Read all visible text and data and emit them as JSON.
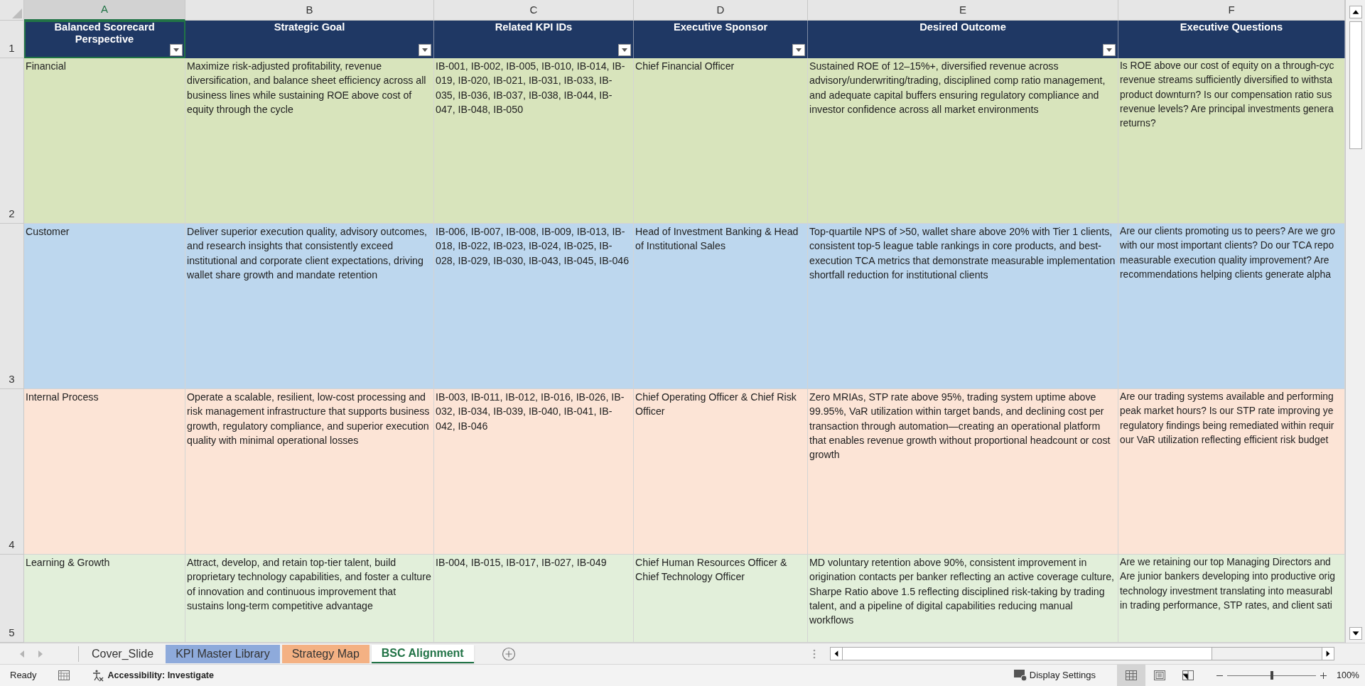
{
  "column_letters": [
    {
      "label": "A",
      "selected": true
    },
    {
      "label": "B",
      "selected": false
    },
    {
      "label": "C",
      "selected": false
    },
    {
      "label": "D",
      "selected": false
    },
    {
      "label": "E",
      "selected": false
    },
    {
      "label": "F",
      "selected": false
    }
  ],
  "header_row": {
    "row_number": "1",
    "cells": [
      {
        "text": "Balanced Scorecard Perspective",
        "filter": true,
        "selected": true
      },
      {
        "text": "Strategic Goal",
        "filter": true,
        "selected": false
      },
      {
        "text": "Related KPI IDs",
        "filter": true,
        "selected": false
      },
      {
        "text": "Executive Sponsor",
        "filter": true,
        "selected": false
      },
      {
        "text": "Desired Outcome",
        "filter": true,
        "selected": false
      },
      {
        "text": "Executive Questions",
        "filter": false,
        "selected": false
      }
    ]
  },
  "rows": [
    {
      "row_number": "2",
      "color": "#d8e4bc",
      "cells": [
        {
          "text": "Financial"
        },
        {
          "text": "Maximize risk-adjusted profitability, revenue diversification, and balance sheet efficiency across all business lines while sustaining ROE above cost of equity through the cycle"
        },
        {
          "text": "IB-001, IB-002, IB-005, IB-010, IB-014, IB-019, IB-020, IB-021, IB-031, IB-033, IB-035, IB-036, IB-037, IB-038, IB-044, IB-047, IB-048, IB-050"
        },
        {
          "text": "Chief Financial Officer"
        },
        {
          "text": "Sustained ROE of 12–15%+, diversified revenue across advisory/underwriting/trading, disciplined comp ratio management, and adequate capital buffers ensuring regulatory compliance and investor confidence across all market environments"
        },
        {
          "lines": [
            "Is ROE above our cost of equity on a through-cyc",
            "revenue streams sufficiently diversified to withsta",
            "product downturn? Is our compensation ratio sus",
            "revenue levels? Are principal investments genera",
            "returns?"
          ]
        }
      ]
    },
    {
      "row_number": "3",
      "color": "#bdd7ee",
      "cells": [
        {
          "text": "Customer"
        },
        {
          "text": "Deliver superior execution quality, advisory outcomes, and research insights that consistently exceed institutional and corporate client expectations, driving wallet share growth and mandate retention"
        },
        {
          "text": "IB-006, IB-007, IB-008, IB-009, IB-013, IB-018, IB-022, IB-023, IB-024, IB-025, IB-028, IB-029, IB-030, IB-043, IB-045, IB-046"
        },
        {
          "text": "Head of Investment Banking & Head of Institutional Sales"
        },
        {
          "text": "Top-quartile NPS of >50, wallet share above 20% with Tier 1 clients, consistent top-5 league table rankings in core products, and best-execution TCA metrics that demonstrate measurable implementation shortfall reduction for institutional clients"
        },
        {
          "lines": [
            "Are our clients promoting us to peers? Are we gro",
            "with our most important clients? Do our TCA repo",
            "measurable execution quality improvement? Are",
            "recommendations helping clients generate alpha"
          ]
        }
      ]
    },
    {
      "row_number": "4",
      "color": "#fce4d6",
      "cells": [
        {
          "text": "Internal Process"
        },
        {
          "text": "Operate a scalable, resilient, low-cost processing and risk management infrastructure that supports business growth, regulatory compliance, and superior execution quality with minimal operational losses"
        },
        {
          "text": "IB-003, IB-011, IB-012, IB-016, IB-026, IB-032, IB-034, IB-039, IB-040, IB-041, IB-042, IB-046"
        },
        {
          "text": "Chief Operating Officer & Chief Risk Officer"
        },
        {
          "text": "Zero MRIAs, STP rate above 95%, trading system uptime above 99.95%, VaR utilization within target bands, and declining cost per transaction through automation—creating an operational platform that enables revenue growth without proportional headcount or cost growth"
        },
        {
          "lines": [
            "Are our trading systems available and performing",
            "peak market hours? Is our STP rate improving ye",
            "regulatory findings being remediated within requir",
            "our VaR utilization reflecting efficient risk budget"
          ]
        }
      ]
    },
    {
      "row_number": "5",
      "color": "#e2efda",
      "cells": [
        {
          "text": "Learning & Growth"
        },
        {
          "text": "Attract, develop, and retain top-tier talent, build proprietary technology capabilities, and foster a culture of innovation and continuous improvement that sustains long-term competitive advantage"
        },
        {
          "text": "IB-004, IB-015, IB-017, IB-027, IB-049"
        },
        {
          "text": "Chief Human Resources Officer & Chief Technology Officer"
        },
        {
          "text": "MD voluntary retention above 90%, consistent improvement in origination contacts per banker reflecting an active coverage culture, Sharpe Ratio above 1.5 reflecting disciplined risk-taking by trading talent, and a pipeline of digital capabilities reducing manual workflows"
        },
        {
          "lines": [
            "Are we retaining our top Managing Directors and",
            "Are junior bankers developing into productive orig",
            "technology investment translating into measurabl",
            "in trading performance, STP rates, and client sati"
          ]
        }
      ]
    }
  ],
  "sheet_tabs": [
    {
      "label": "Cover_Slide",
      "selected": false
    },
    {
      "label": "KPI Master Library",
      "selected": false,
      "color": "#8eaadb"
    },
    {
      "label": "Strategy Map",
      "selected": false,
      "color": "#f4b183"
    },
    {
      "label": "BSC Alignment",
      "selected": true
    }
  ],
  "status_bar": {
    "status": "Ready",
    "accessibility": "Accessibility: Investigate",
    "display_settings": "Display Settings",
    "views": [
      {
        "kind": "normal",
        "selected": true
      },
      {
        "kind": "page-layout",
        "selected": false
      },
      {
        "kind": "page-break",
        "selected": false
      }
    ],
    "zoom": {
      "level": 0.5,
      "reading": "100%"
    }
  }
}
